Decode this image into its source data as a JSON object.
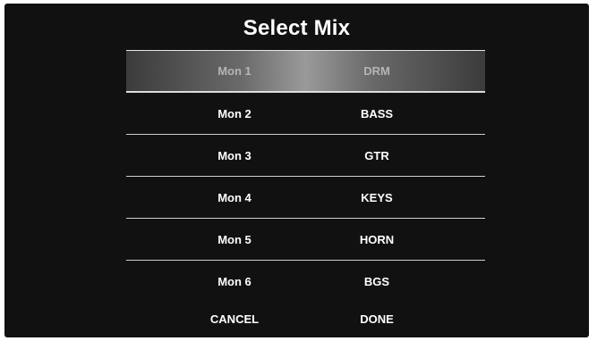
{
  "title": "Select Mix",
  "mixes": [
    {
      "mon": "Mon 1",
      "label": "DRM",
      "selected": true
    },
    {
      "mon": "Mon 2",
      "label": "BASS",
      "selected": false
    },
    {
      "mon": "Mon 3",
      "label": "GTR",
      "selected": false
    },
    {
      "mon": "Mon 4",
      "label": "KEYS",
      "selected": false
    },
    {
      "mon": "Mon 5",
      "label": "HORN",
      "selected": false
    },
    {
      "mon": "Mon 6",
      "label": "BGS",
      "selected": false
    }
  ],
  "buttons": {
    "cancel_label": "CANCEL",
    "done_label": "DONE"
  }
}
